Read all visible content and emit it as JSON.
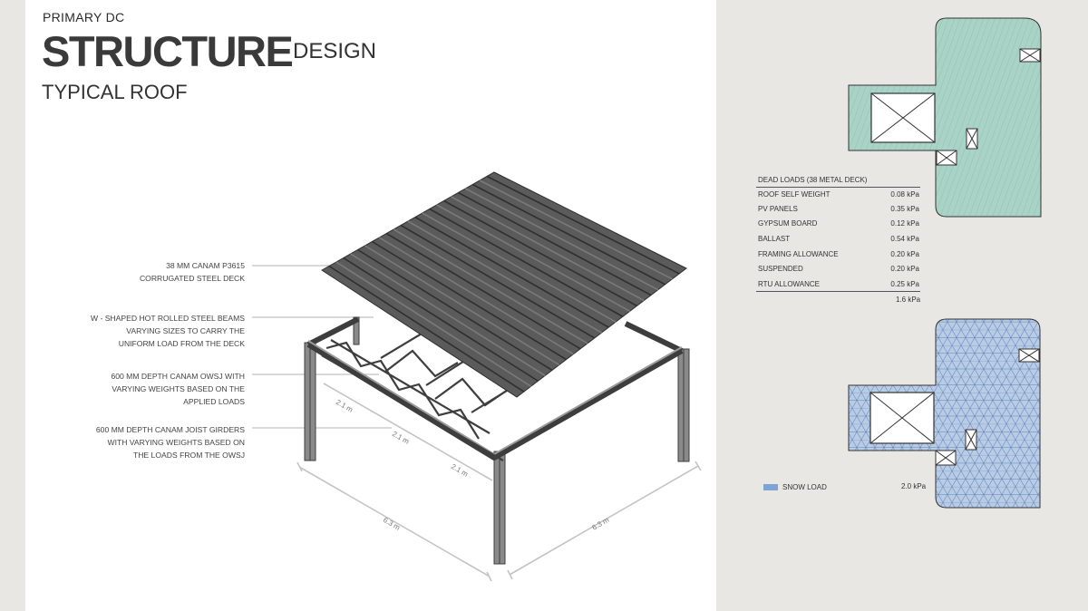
{
  "header": {
    "eyebrow": "PRIMARY DC",
    "title": "STRUCTURE",
    "title_suffix": "DESIGN",
    "subtitle": "TYPICAL ROOF"
  },
  "callouts": [
    {
      "lines": [
        "38 mm CANAM P3615",
        "CORRUGATED STEEL DECK"
      ]
    },
    {
      "lines": [
        "W - SHAPED HOT ROLLED STEEL BEAMS",
        "VARYING SIZES TO CARRY THE",
        "UNIFORM LOAD FROM THE DECK"
      ]
    },
    {
      "lines": [
        "600 mm DEPTH CANAM OWSJ WITH",
        "VARYING WEIGHTS BASED ON THE",
        "APPLIED LOADS"
      ]
    },
    {
      "lines": [
        "600 mm DEPTH CANAM JOIST GIRDERS",
        "WITH VARYING WEIGHTS BASED ON",
        "THE LOADS FROM THE OWSJ"
      ]
    }
  ],
  "dimensions": {
    "bay_1": "2.1 m",
    "bay_2": "2.1 m",
    "bay_3": "2.1 m",
    "span_left": "6.3 m",
    "span_right": "6.3 m"
  },
  "dead_loads": {
    "title": "DEAD LOADS (38 METAL DECK)",
    "rows": [
      {
        "name": "ROOF SELF WEIGHT",
        "value": "0.08 kPa"
      },
      {
        "name": "PV PANELS",
        "value": "0.35 kPa"
      },
      {
        "name": "GYPSUM BOARD",
        "value": "0.12 kPa"
      },
      {
        "name": "BALLAST",
        "value": "0.54 kPa"
      },
      {
        "name": "FRAMING ALLOWANCE",
        "value": "0.20 kPa"
      },
      {
        "name": "SUSPENDED",
        "value": "0.20 kPa"
      },
      {
        "name": "RTU ALLOWANCE",
        "value": "0.25 kPa"
      }
    ],
    "total": "1.6 kPa"
  },
  "snow_load": {
    "label": "SNOW LOAD",
    "value": "2.0 kPa"
  },
  "colors": {
    "dead_load_fill": "#a9d3c6",
    "snow_load_fill": "#b9cce6",
    "steel": "#4a4a4a"
  }
}
